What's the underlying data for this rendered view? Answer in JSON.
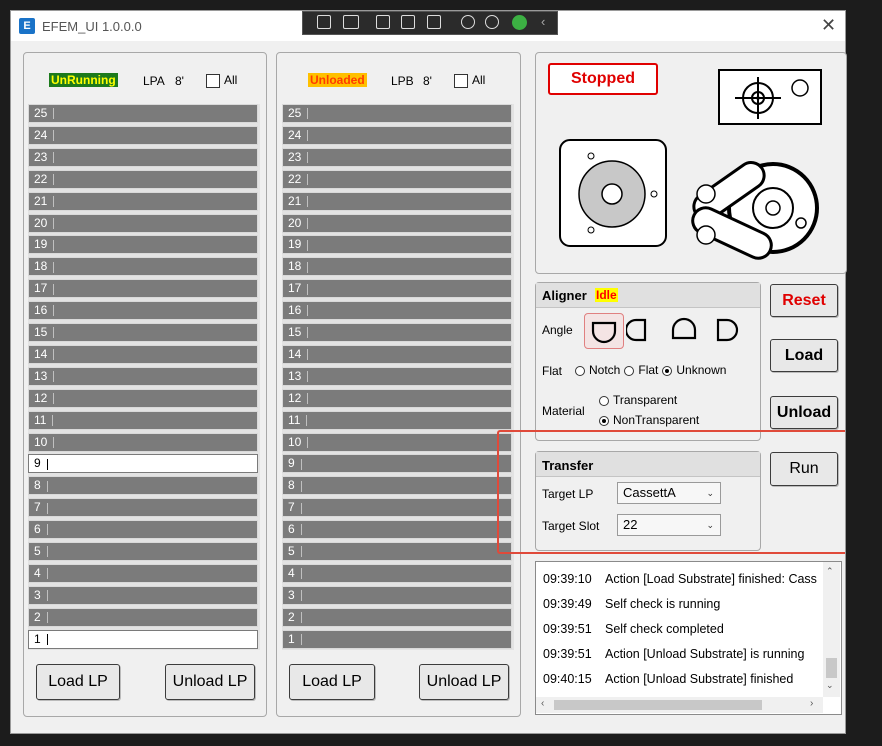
{
  "window": {
    "title": "EFEM_UI 1.0.0.0",
    "app_icon_text": "E",
    "close_glyph": "✕"
  },
  "lpa": {
    "status": "UnRunning",
    "status_bg": "#1c7a1c",
    "status_fg": "#ffff00",
    "label": "LPA",
    "size": "8'",
    "all_label": "All",
    "slots": [
      {
        "n": "25",
        "filled": false
      },
      {
        "n": "24",
        "filled": false
      },
      {
        "n": "23",
        "filled": false
      },
      {
        "n": "22",
        "filled": false
      },
      {
        "n": "21",
        "filled": false
      },
      {
        "n": "20",
        "filled": false
      },
      {
        "n": "19",
        "filled": false
      },
      {
        "n": "18",
        "filled": false
      },
      {
        "n": "17",
        "filled": false
      },
      {
        "n": "16",
        "filled": false
      },
      {
        "n": "15",
        "filled": false
      },
      {
        "n": "14",
        "filled": false
      },
      {
        "n": "13",
        "filled": false
      },
      {
        "n": "12",
        "filled": false
      },
      {
        "n": "11",
        "filled": false
      },
      {
        "n": "10",
        "filled": false
      },
      {
        "n": "9",
        "filled": true
      },
      {
        "n": "8",
        "filled": false
      },
      {
        "n": "7",
        "filled": false
      },
      {
        "n": "6",
        "filled": false
      },
      {
        "n": "5",
        "filled": false
      },
      {
        "n": "4",
        "filled": false
      },
      {
        "n": "3",
        "filled": false
      },
      {
        "n": "2",
        "filled": false
      },
      {
        "n": "1",
        "filled": true
      }
    ],
    "load_label": "Load LP",
    "unload_label": "Unload LP"
  },
  "lpb": {
    "status": "Unloaded",
    "status_bg": "#ffc000",
    "status_fg": "#ff3c00",
    "label": "LPB",
    "size": "8'",
    "all_label": "All",
    "slots": [
      {
        "n": "25",
        "filled": false
      },
      {
        "n": "24",
        "filled": false
      },
      {
        "n": "23",
        "filled": false
      },
      {
        "n": "22",
        "filled": false
      },
      {
        "n": "21",
        "filled": false
      },
      {
        "n": "20",
        "filled": false
      },
      {
        "n": "19",
        "filled": false
      },
      {
        "n": "18",
        "filled": false
      },
      {
        "n": "17",
        "filled": false
      },
      {
        "n": "16",
        "filled": false
      },
      {
        "n": "15",
        "filled": false
      },
      {
        "n": "14",
        "filled": false
      },
      {
        "n": "13",
        "filled": false
      },
      {
        "n": "12",
        "filled": false
      },
      {
        "n": "11",
        "filled": false
      },
      {
        "n": "10",
        "filled": false
      },
      {
        "n": "9",
        "filled": false
      },
      {
        "n": "8",
        "filled": false
      },
      {
        "n": "7",
        "filled": false
      },
      {
        "n": "6",
        "filled": false
      },
      {
        "n": "5",
        "filled": false
      },
      {
        "n": "4",
        "filled": false
      },
      {
        "n": "3",
        "filled": false
      },
      {
        "n": "2",
        "filled": false
      },
      {
        "n": "1",
        "filled": false
      }
    ],
    "load_label": "Load LP",
    "unload_label": "Unload LP"
  },
  "robot": {
    "state": "Stopped",
    "state_color": "#e00000"
  },
  "aligner": {
    "title": "Aligner",
    "state": "Idle",
    "state_bg": "#ffff00",
    "state_fg": "#ff0000",
    "angle_label": "Angle",
    "flat_label": "Flat",
    "flat_options": [
      "Notch",
      "Flat",
      "Unknown"
    ],
    "flat_selected": "Unknown",
    "material_label": "Material",
    "material_options": [
      "Transparent",
      "NonTransparent"
    ],
    "material_selected": "NonTransparent"
  },
  "buttons": {
    "reset": "Reset",
    "load": "Load",
    "unload": "Unload",
    "run": "Run",
    "reset_color": "#e00000"
  },
  "transfer": {
    "title": "Transfer",
    "target_lp_label": "Target LP",
    "target_lp_value": "CassettA",
    "target_slot_label": "Target Slot",
    "target_slot_value": "22",
    "highlight_color": "#e04a3a"
  },
  "log": [
    {
      "time": "09:39:10",
      "msg": "Action [Load Substrate] finished: Cass"
    },
    {
      "time": "09:39:49",
      "msg": "Self check is running"
    },
    {
      "time": "09:39:51",
      "msg": "Self check completed"
    },
    {
      "time": "09:39:51",
      "msg": "Action [Unload Substrate] is running"
    },
    {
      "time": "09:40:15",
      "msg": "Action [Unload Substrate] finished"
    }
  ]
}
